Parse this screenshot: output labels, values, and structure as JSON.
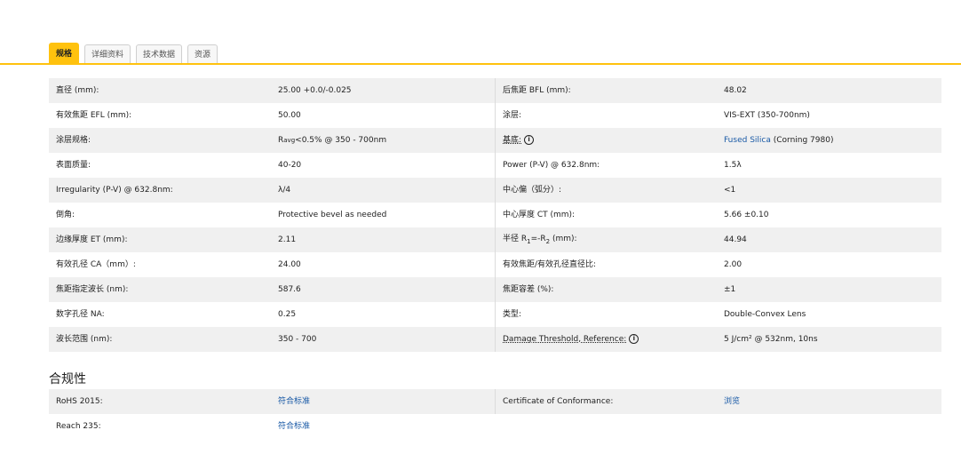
{
  "tabs": [
    {
      "label": "规格",
      "active": true
    },
    {
      "label": "详细资料",
      "active": false
    },
    {
      "label": "技术数据",
      "active": false
    },
    {
      "label": "资源",
      "active": false
    }
  ],
  "accent_color": "#ffc20e",
  "link_color": "#1a5aa6",
  "specs": [
    {
      "l1": "直径 (mm):",
      "v1": "25.00 +0.0/-0.025",
      "l2": "后焦距 BFL (mm):",
      "v2": "48.02"
    },
    {
      "l1": "有效焦距 EFL (mm):",
      "v1": "50.00",
      "l2": "涂层:",
      "v2": "VIS-EXT (350-700nm)"
    },
    {
      "l1": "涂层规格:",
      "v1_prefix": "R",
      "v1_sub": "avg",
      "v1_suffix": " <0.5% @ 350 - 700nm",
      "l2": "基底:",
      "v2_link": "Fused Silica",
      "v2_rest": " (Corning 7980)"
    },
    {
      "l1": "表面质量:",
      "v1": "40-20",
      "l2": "Power (P-V) @ 632.8nm:",
      "v2": "1.5λ"
    },
    {
      "l1": "Irregularity (P-V) @ 632.8nm:",
      "v1": "λ/4",
      "l2": "中心偏（弧分）:",
      "v2": "<1"
    },
    {
      "l1": "倒角:",
      "v1": "Protective bevel as needed",
      "l2": "中心厚度 CT (mm):",
      "v2": "5.66 ±0.10"
    },
    {
      "l1": "边缘厚度 ET (mm):",
      "v1": "2.11",
      "l2_prefix": "半径 R",
      "l2_sub1": "1",
      "l2_mid": "=-R",
      "l2_sub2": "2",
      "l2_suffix": " (mm):",
      "v2": "44.94"
    },
    {
      "l1": "有效孔径 CA（mm）:",
      "v1": "24.00",
      "l2": "有效焦距/有效孔径直径比:",
      "v2": "2.00"
    },
    {
      "l1": "焦距指定波长 (nm):",
      "v1": "587.6",
      "l2": "焦距容差 (%):",
      "v2": "±1"
    },
    {
      "l1": "数字孔径 NA:",
      "v1": "0.25",
      "l2": "类型:",
      "v2": "Double-Convex Lens"
    },
    {
      "l1": "波长范围 (nm):",
      "v1": "350 - 700",
      "l2": "Damage Threshold, Reference:",
      "v2": "5 J/cm² @ 532nm, 10ns"
    }
  ],
  "compliance": {
    "title": "合规性",
    "rows": [
      {
        "l1": "RoHS 2015:",
        "v1": "符合标准",
        "l2": "Certificate of Conformance:",
        "v2": "浏览"
      },
      {
        "l1": "Reach 235:",
        "v1": "符合标准",
        "l2": "",
        "v2": ""
      }
    ]
  }
}
